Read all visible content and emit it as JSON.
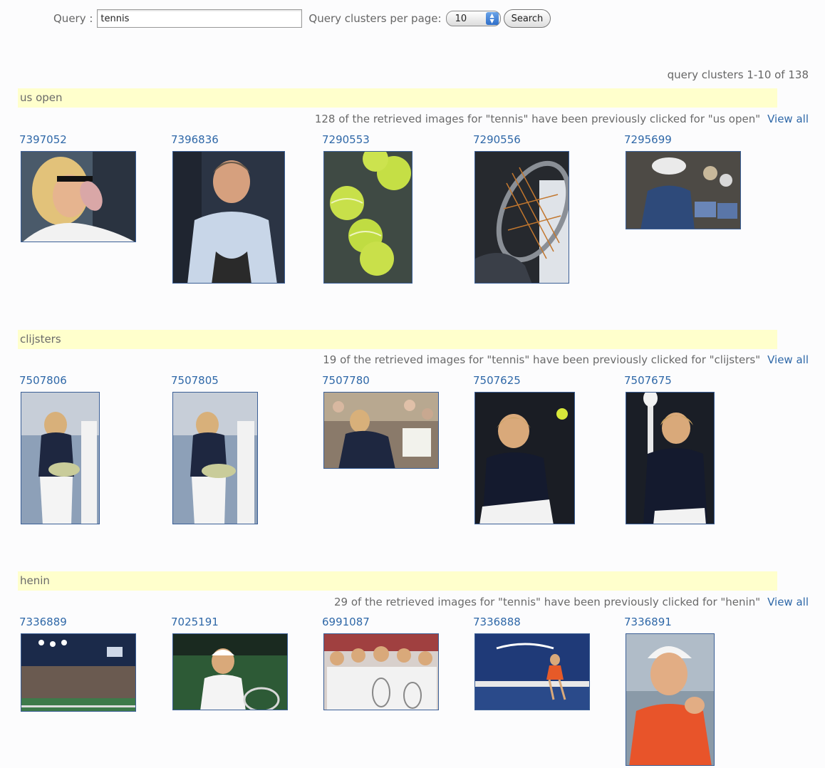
{
  "search": {
    "query_label": "Query :",
    "query_value": "tennis",
    "per_page_label": "Query clusters per page:",
    "per_page_value": "10",
    "search_button": "Search"
  },
  "results_range": "query clusters 1-10 of 138",
  "clusters": [
    {
      "title": "us open",
      "info": "128 of the retrieved images for \"tennis\" have been previously clicked for \"us open\"",
      "view_all": "View all",
      "images": [
        {
          "id": "7397052"
        },
        {
          "id": "7396836"
        },
        {
          "id": "7290553"
        },
        {
          "id": "7290556"
        },
        {
          "id": "7295699"
        }
      ]
    },
    {
      "title": "clijsters",
      "info": "19 of the retrieved images for \"tennis\" have been previously clicked for \"clijsters\"",
      "view_all": "View all",
      "images": [
        {
          "id": "7507806"
        },
        {
          "id": "7507805"
        },
        {
          "id": "7507780"
        },
        {
          "id": "7507625"
        },
        {
          "id": "7507675"
        }
      ]
    },
    {
      "title": "henin",
      "info": "29 of the retrieved images for \"tennis\" have been previously clicked for \"henin\"",
      "view_all": "View all",
      "images": [
        {
          "id": "7336889"
        },
        {
          "id": "7025191"
        },
        {
          "id": "6991087"
        },
        {
          "id": "7336888"
        },
        {
          "id": "7336891"
        }
      ]
    }
  ]
}
